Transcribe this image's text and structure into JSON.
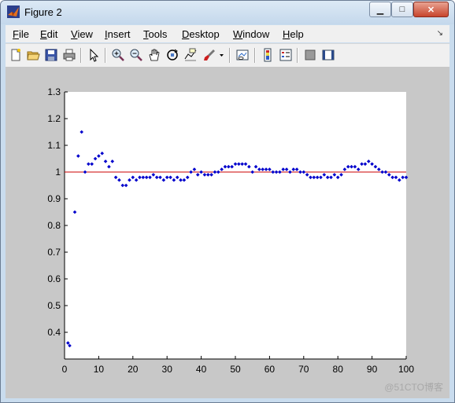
{
  "window": {
    "title": "Figure 2",
    "controls": {
      "minimize": "▁",
      "maximize": "□",
      "close": "✕"
    }
  },
  "menubar": {
    "items": [
      {
        "first": "F",
        "rest": "ile"
      },
      {
        "first": "E",
        "rest": "dit"
      },
      {
        "first": "V",
        "rest": "iew"
      },
      {
        "first": "I",
        "rest": "nsert"
      },
      {
        "first": "T",
        "rest": "ools"
      },
      {
        "first": "D",
        "rest": "esktop"
      },
      {
        "first": "W",
        "rest": "indow"
      },
      {
        "first": "H",
        "rest": "elp"
      }
    ],
    "dock_arrow": "↘"
  },
  "toolbar": {
    "icons": [
      "new-figure-icon",
      "open-file-icon",
      "save-icon",
      "print-icon",
      "edit-plot-icon",
      "zoom-in-icon",
      "zoom-out-icon",
      "pan-icon",
      "rotate-3d-icon",
      "data-cursor-icon",
      "brush-icon",
      "brush-dropdown-icon",
      "link-plot-icon",
      "insert-colorbar-icon",
      "insert-legend-icon",
      "hide-plot-tools-icon",
      "show-plot-tools-icon"
    ]
  },
  "watermark": "@51CTO博客",
  "colors": {
    "line": "#cc0000",
    "markers": "#0000cc",
    "figure_bg": "#c8c8c8",
    "axes_bg": "#ffffff"
  },
  "chart_data": {
    "type": "scatter",
    "xlim": [
      0,
      100
    ],
    "ylim": [
      0.3,
      1.3
    ],
    "xticks": [
      0,
      10,
      20,
      30,
      40,
      50,
      60,
      70,
      80,
      90,
      100
    ],
    "yticks": [
      0.4,
      0.5,
      0.6,
      0.7,
      0.8,
      0.9,
      1,
      1.1,
      1.2,
      1.3
    ],
    "xtick_labels": [
      "0",
      "10",
      "20",
      "30",
      "40",
      "50",
      "60",
      "70",
      "80",
      "90",
      "100"
    ],
    "ytick_labels": [
      "0.4",
      "0.5",
      "0.6",
      "0.7",
      "0.8",
      "0.9",
      "1",
      "1.1",
      "1.2",
      "1.3"
    ],
    "reference_line": {
      "y": 1
    },
    "series": [
      {
        "x": [
          1,
          1.5,
          3,
          4,
          5,
          6,
          7,
          8,
          9,
          10,
          11,
          12,
          13,
          14,
          15,
          16,
          17,
          18,
          19,
          20,
          21,
          22,
          23,
          24,
          25,
          26,
          27,
          28,
          29,
          30,
          31,
          32,
          33,
          34,
          35,
          36,
          37,
          38,
          39,
          40,
          41,
          42,
          43,
          44,
          45,
          46,
          47,
          48,
          49,
          50,
          51,
          52,
          53,
          54,
          55,
          56,
          57,
          58,
          59,
          60,
          61,
          62,
          63,
          64,
          65,
          66,
          67,
          68,
          69,
          70,
          71,
          72,
          73,
          74,
          75,
          76,
          77,
          78,
          79,
          80,
          81,
          82,
          83,
          84,
          85,
          86,
          87,
          88,
          89,
          90,
          91,
          92,
          93,
          94,
          95,
          96,
          97,
          98,
          99,
          100
        ],
        "y": [
          0.36,
          0.35,
          0.85,
          1.06,
          1.15,
          1.0,
          1.03,
          1.03,
          1.05,
          1.06,
          1.07,
          1.04,
          1.02,
          1.04,
          0.98,
          0.97,
          0.95,
          0.95,
          0.97,
          0.98,
          0.97,
          0.98,
          0.98,
          0.98,
          0.98,
          0.99,
          0.98,
          0.98,
          0.97,
          0.98,
          0.98,
          0.97,
          0.98,
          0.97,
          0.97,
          0.98,
          1.0,
          1.01,
          0.99,
          1.0,
          0.99,
          0.99,
          0.99,
          1.0,
          1.0,
          1.01,
          1.02,
          1.02,
          1.02,
          1.03,
          1.03,
          1.03,
          1.03,
          1.02,
          1.0,
          1.02,
          1.01,
          1.01,
          1.01,
          1.01,
          1.0,
          1.0,
          1.0,
          1.01,
          1.01,
          1.0,
          1.01,
          1.01,
          1.0,
          1.0,
          0.99,
          0.98,
          0.98,
          0.98,
          0.98,
          0.99,
          0.98,
          0.98,
          0.99,
          0.98,
          0.99,
          1.01,
          1.02,
          1.02,
          1.02,
          1.01,
          1.03,
          1.03,
          1.04,
          1.03,
          1.02,
          1.01,
          1.0,
          1.0,
          0.99,
          0.98,
          0.98,
          0.97,
          0.98,
          0.98
        ]
      }
    ]
  }
}
